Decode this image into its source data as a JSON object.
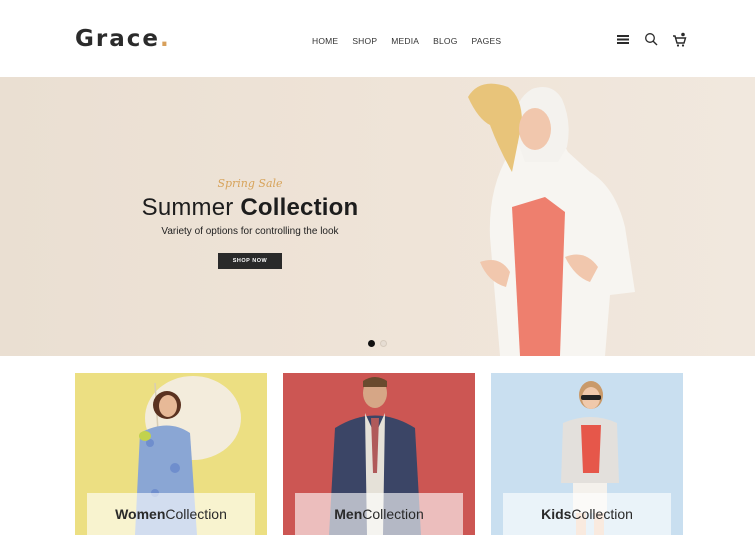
{
  "brand": {
    "name": "Grace",
    "dot": "."
  },
  "nav": [
    "HOME",
    "SHOP",
    "MEDIA",
    "BLOG",
    "PAGES"
  ],
  "header_icons": [
    "menu-icon",
    "search-icon",
    "cart-icon"
  ],
  "hero": {
    "eyebrow": "Spring Sale",
    "title_light": "Summer ",
    "title_bold": "Collection",
    "subtitle": "Variety of options for controlling the look",
    "button": "SHOP NOW",
    "slides": 2,
    "active_slide": 1
  },
  "collections": [
    {
      "bold": "Women",
      "light": "Collection",
      "bg": "#ecdf82"
    },
    {
      "bold": "Men",
      "light": "Collection",
      "bg": "#cc5653"
    },
    {
      "bold": "Kids",
      "light": "Collection",
      "bg": "#c9dff0"
    }
  ],
  "colors": {
    "accent": "#d7a35a",
    "text": "#1d1d1d",
    "button": "#2a2a2a"
  }
}
